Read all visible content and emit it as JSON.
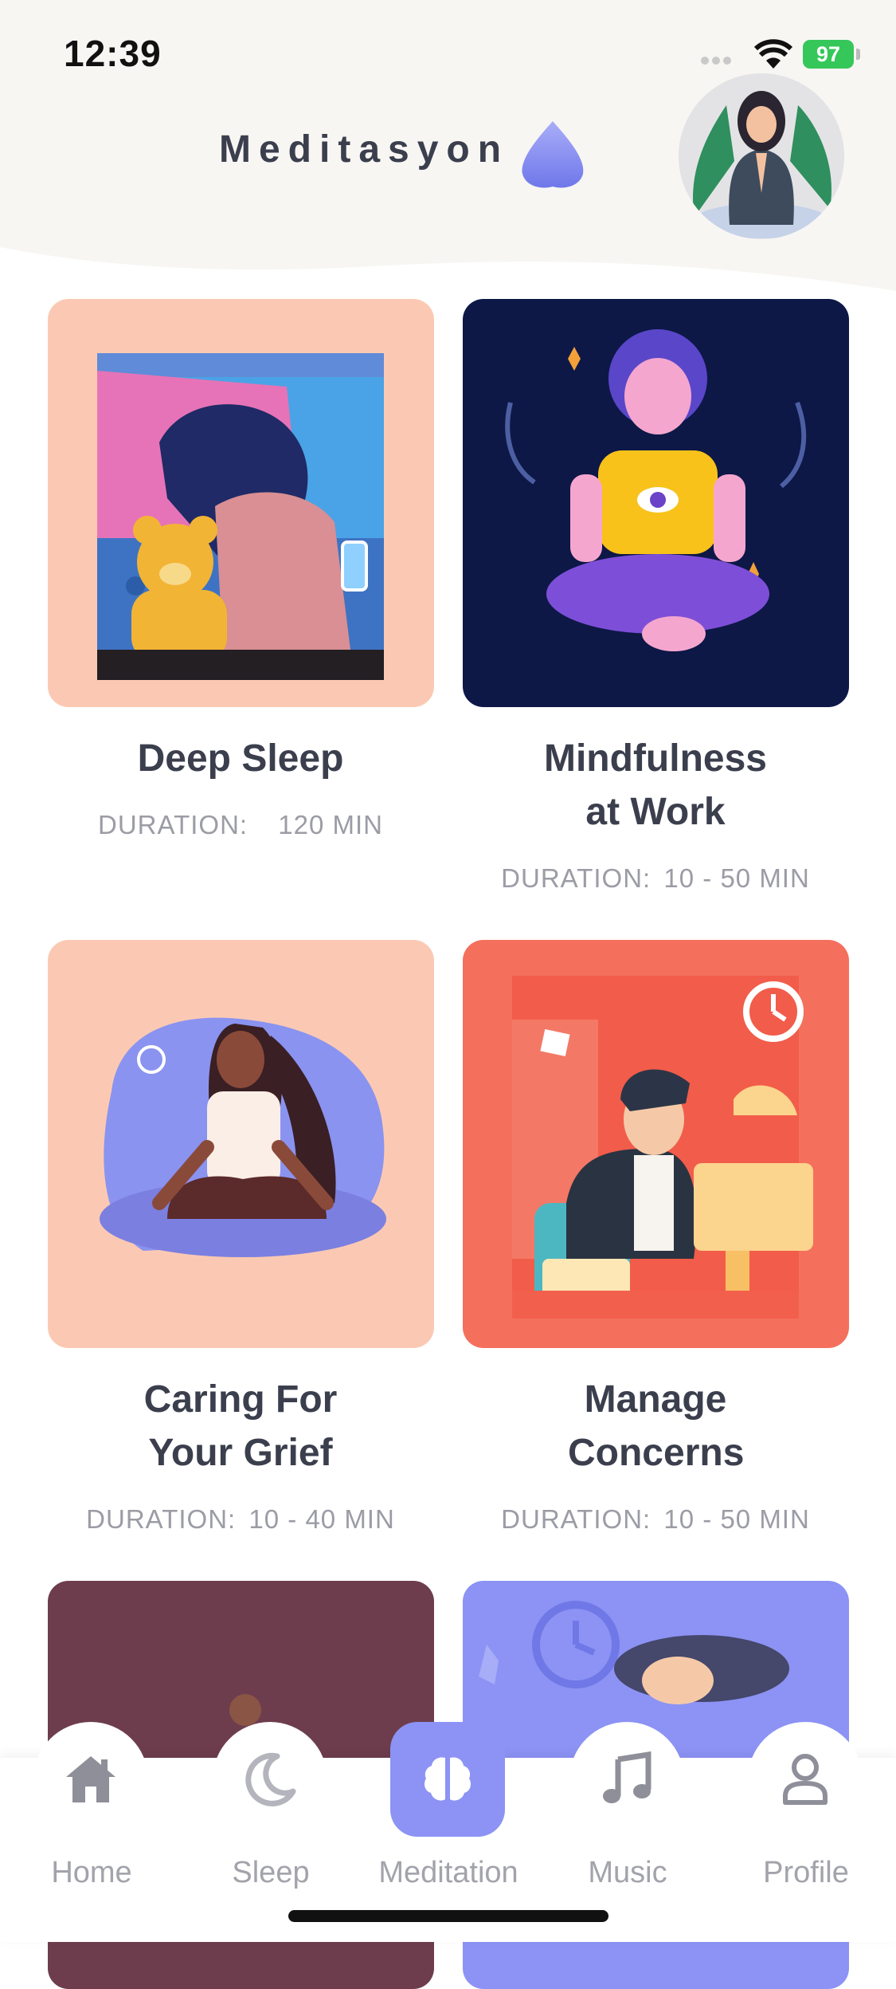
{
  "status_bar": {
    "time": "12:39",
    "battery": "97"
  },
  "header": {
    "title": "Meditasyon"
  },
  "cards": [
    {
      "title": "Deep Sleep",
      "duration_label": "DURATION:",
      "duration_value": "120 MIN",
      "bg": "#fbc9b3"
    },
    {
      "title": "Mindfulness at Work",
      "duration_label": "DURATION:",
      "duration_value": "10 - 50 MIN",
      "bg": "#0d1847"
    },
    {
      "title": "Caring For Your Grief",
      "duration_label": "DURATION:",
      "duration_value": "10 - 40 MIN",
      "bg": "#fbc9b3"
    },
    {
      "title": "Manage Concerns",
      "duration_label": "DURATION:",
      "duration_value": "10 - 50 MIN",
      "bg": "#f4705c"
    },
    {
      "title": "",
      "bg": "#6d3d4d"
    },
    {
      "title": "",
      "bg": "#8c93f4"
    }
  ],
  "tabs": [
    {
      "label": "Home",
      "icon": "home-icon"
    },
    {
      "label": "Sleep",
      "icon": "moon-icon"
    },
    {
      "label": "Meditation",
      "icon": "brain-icon",
      "active": true
    },
    {
      "label": "Music",
      "icon": "music-note-icon"
    },
    {
      "label": "Profile",
      "icon": "user-icon"
    }
  ],
  "colors": {
    "accent": "#8c93f4",
    "title_text": "#3b3f4d",
    "meta_text": "#9b9ca5"
  }
}
